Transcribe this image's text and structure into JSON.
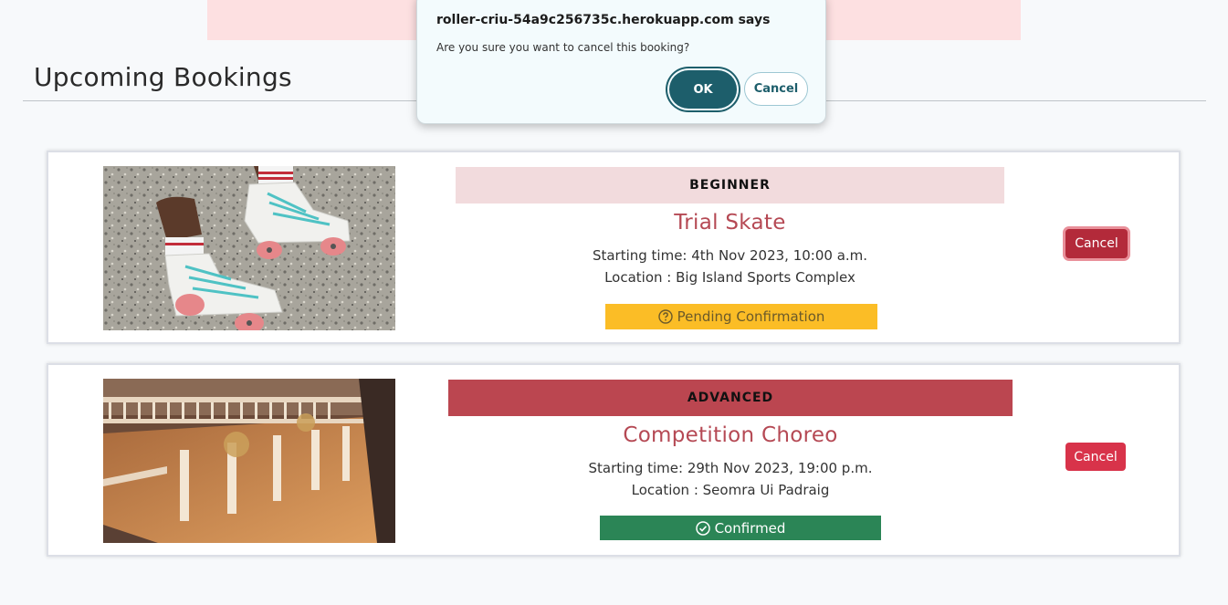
{
  "page": {
    "heading": "Upcoming Bookings"
  },
  "dialog": {
    "title": "roller-criu-54a9c256735c.herokuapp.com says",
    "message": "Are you sure you want to cancel this booking?",
    "ok_label": "OK",
    "cancel_label": "Cancel"
  },
  "bookings": [
    {
      "level": "BEGINNER",
      "title": "Trial Skate",
      "starting_time": "Starting time: 4th Nov 2023, 10:00 a.m.",
      "location": "Location : Big Island Sports Complex",
      "status": "Pending Confirmation",
      "status_icon": "question-circle-icon",
      "status_color": "#fbbd26",
      "cancel_label": "Cancel",
      "image": "roller-skates-photo"
    },
    {
      "level": "ADVANCED",
      "title": "Competition Choreo",
      "starting_time": "Starting time: 29th Nov 2023, 19:00 p.m.",
      "location": "Location : Seomra Ui Padraig",
      "status": "Confirmed",
      "status_icon": "check-circle-icon",
      "status_color": "#2b8556",
      "cancel_label": "Cancel",
      "image": "ballroom-hall-photo"
    }
  ],
  "colors": {
    "accent": "#b54954",
    "dialog_primary": "#1d5e6b",
    "cancel_button": "#d8334a"
  }
}
